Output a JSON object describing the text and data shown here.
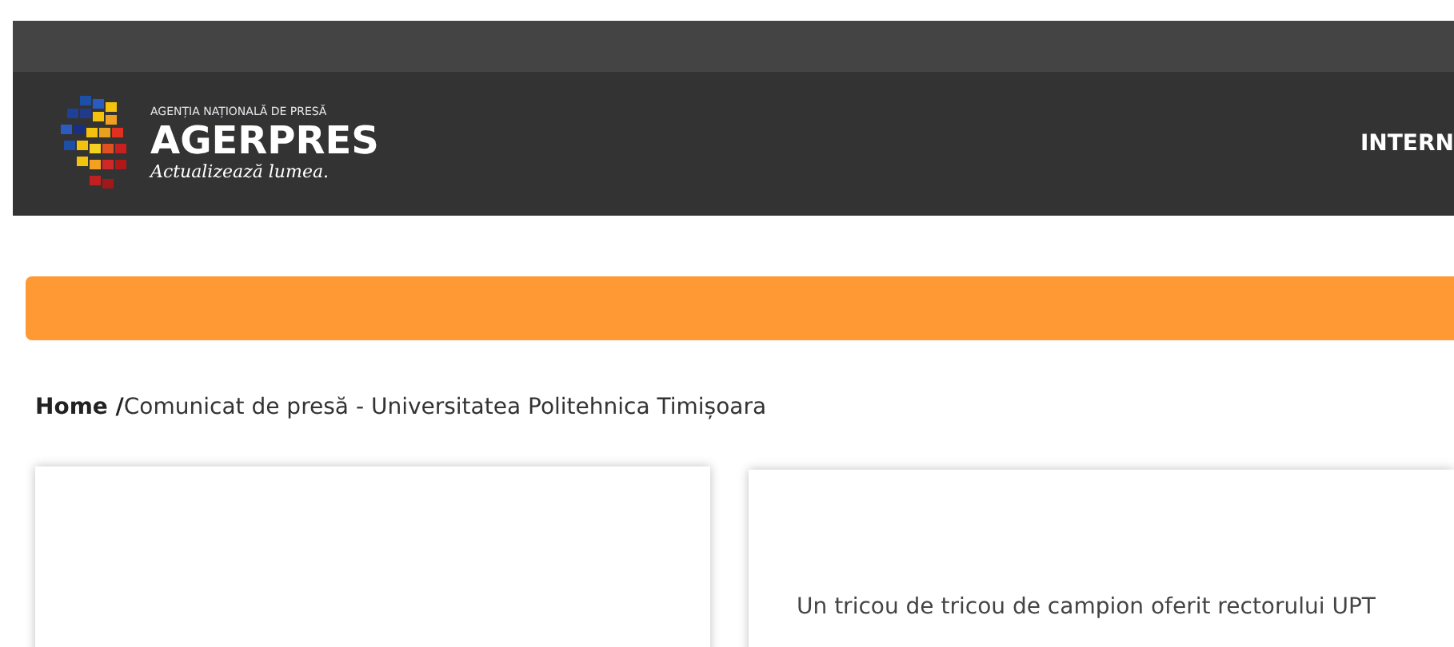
{
  "header": {
    "logo": {
      "overline": "AGENȚIA NAȚIONALĂ DE PRESĂ",
      "name": "AGERPRES",
      "tagline": "Actualizează lumea."
    },
    "nav_items": [
      "INTERN"
    ]
  },
  "breadcrumb": {
    "home": "Home /",
    "current": "Comunicat de presă - Universitatea Politehnica Timișoara"
  },
  "article": {
    "text": "Un tricou de tricou de campion oferit rectorului UPT"
  }
}
